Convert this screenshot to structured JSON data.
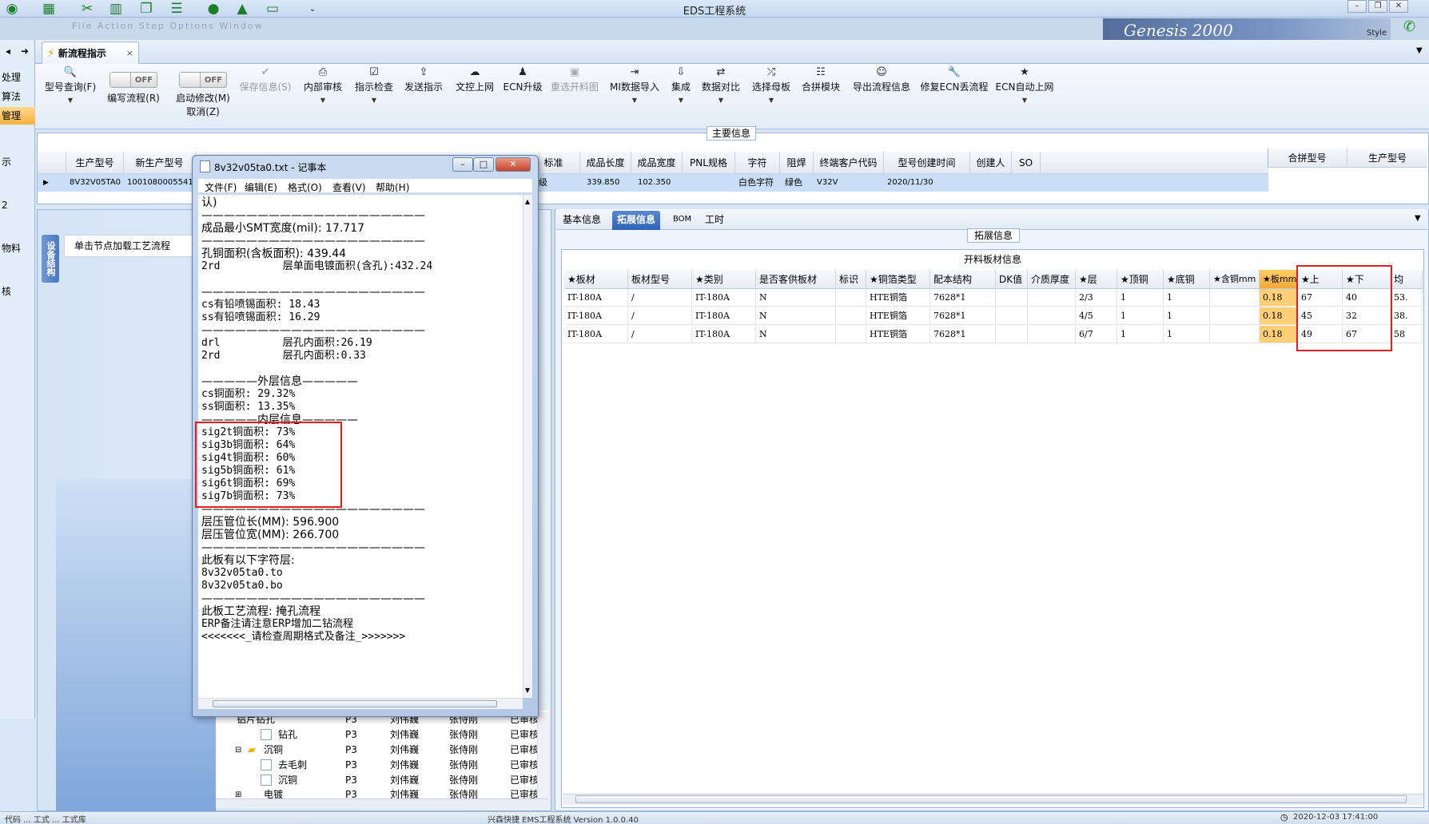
{
  "window": {
    "title": "EDS工程系统",
    "style_label": "Style",
    "genesis_banner": "Genesis 2000",
    "menu_ghost": "File  Action  Step  Options  Window"
  },
  "left_nav": {
    "items": [
      "处理",
      "算法",
      "管理",
      "示",
      "2",
      "物料",
      "核"
    ]
  },
  "doc_tab": {
    "label": "新流程指示",
    "close": "×"
  },
  "toolbar": {
    "items": [
      {
        "label": "型号查询(F)",
        "icon": "search-icon",
        "arrow": true,
        "disabled": false
      },
      {
        "label": "编写流程(R)",
        "toggle": "OFF",
        "disabled": false
      },
      {
        "label": "启动修改(M)",
        "label2": "取消(Z)",
        "toggle": "OFF",
        "disabled": false
      },
      {
        "label": "保存信息(S)",
        "icon": "check-icon",
        "disabled": true
      },
      {
        "label": "内部审核",
        "icon": "printer-icon",
        "arrow": true,
        "disabled": false
      },
      {
        "label": "指示检查",
        "icon": "checkbox-icon",
        "arrow": true,
        "disabled": false
      },
      {
        "label": "发送指示",
        "icon": "upload-icon",
        "disabled": false
      },
      {
        "label": "文控上网",
        "icon": "cloud-upload-icon",
        "disabled": false
      },
      {
        "label": "ECN升级",
        "icon": "people-icon",
        "disabled": false
      },
      {
        "label": "重选开料图",
        "icon": "image-icon",
        "disabled": true
      },
      {
        "label": "MI数据导入",
        "icon": "import-icon",
        "arrow": true,
        "disabled": false
      },
      {
        "label": "集成",
        "icon": "download-icon",
        "arrow": true,
        "disabled": false
      },
      {
        "label": "数据对比",
        "icon": "compare-icon",
        "arrow": true,
        "disabled": false
      },
      {
        "label": "选择母板",
        "icon": "shuffle-icon",
        "arrow": true,
        "disabled": false
      },
      {
        "label": "合拼模块",
        "icon": "list-icon",
        "disabled": false
      },
      {
        "label": "导出流程信息",
        "icon": "smiley-icon",
        "disabled": false
      },
      {
        "label": "修复ECN丢流程",
        "icon": "wrench-icon",
        "disabled": false
      },
      {
        "label": "ECN自动上网",
        "icon": "star-icon",
        "arrow": true,
        "disabled": false
      }
    ],
    "off_text": "OFF"
  },
  "main_info": {
    "label": "主要信息",
    "headers": [
      "生产型号",
      "新生产型号",
      "标准",
      "成品长度",
      "成品宽度",
      "PNL规格",
      "字符",
      "阻焊",
      "终端客户代码",
      "型号创建时间",
      "创建人",
      "SO"
    ],
    "row": {
      "prod_no": "8V32V05TA0",
      "new_prod_no": "10010800055417",
      "std": "级",
      "length": "339.850",
      "width": "102.350",
      "char": "白色字符",
      "mask": "绿色",
      "customer": "V32V",
      "created": "2020/11/30"
    },
    "right_headers": [
      "合拼型号",
      "生产型号"
    ]
  },
  "tree_panel": {
    "vtab": "设备结构",
    "tip": "单击节点加载工艺流程",
    "rows": [
      {
        "name": "铝片钻孔",
        "c1": "P3",
        "c2": "刘伟巍",
        "c3": "张侍刚",
        "c4": "已审核"
      },
      {
        "name": "钻孔",
        "c1": "P3",
        "c2": "刘伟巍",
        "c3": "张侍刚",
        "c4": "已审核"
      },
      {
        "name": "沉铜",
        "c1": "P3",
        "c2": "刘伟巍",
        "c3": "张侍刚",
        "c4": "已审核"
      },
      {
        "name": "去毛刺",
        "c1": "P3",
        "c2": "刘伟巍",
        "c3": "张侍刚",
        "c4": "已审核"
      },
      {
        "name": "沉铜",
        "c1": "P3",
        "c2": "刘伟巍",
        "c3": "张侍刚",
        "c4": "已审核"
      },
      {
        "name": "电镀",
        "c1": "P3",
        "c2": "刘伟巍",
        "c3": "张侍刚",
        "c4": "已审核"
      }
    ]
  },
  "right_tabs": [
    "基本信息",
    "拓展信息",
    "BOM",
    "工时"
  ],
  "ext_info": {
    "label": "拓展信息",
    "grid_title": "开料板材信息",
    "headers": [
      "★板材",
      "板材型号",
      "★类别",
      "是否客供板材",
      "标识",
      "★铜箔类型",
      "配本结构",
      "DK值",
      "介质厚度",
      "★层",
      "★顶铜",
      "★底铜",
      "★含铜mm",
      "★板mm",
      "★上",
      "★下",
      "均"
    ],
    "rows": [
      [
        "IT-180A",
        "/",
        "IT-180A",
        "N",
        "",
        "HTE铜箔",
        "7628*1",
        "",
        "",
        "2/3",
        "1",
        "1",
        "",
        "0.18",
        "67",
        "40",
        "53."
      ],
      [
        "IT-180A",
        "/",
        "IT-180A",
        "N",
        "",
        "HTE铜箔",
        "7628*1",
        "",
        "",
        "4/5",
        "1",
        "1",
        "",
        "0.18",
        "45",
        "32",
        "38."
      ],
      [
        "IT-180A",
        "/",
        "IT-180A",
        "N",
        "",
        "HTE铜箔",
        "7628*1",
        "",
        "",
        "6/7",
        "1",
        "1",
        "",
        "0.18",
        "49",
        "67",
        "58"
      ]
    ]
  },
  "notepad": {
    "title": "8v32v05ta0.txt - 记事本",
    "menu": [
      "文件(F)",
      "编辑(E)",
      "格式(O)",
      "查看(V)",
      "帮助(H)"
    ],
    "lines": [
      "认)",
      "————————————————————",
      "成品最小SMT宽度(mil): 17.717",
      "————————————————————",
      "孔铜面积(含板面积): 439.44",
      "2rd          层单面电镀面积(含孔):432.24",
      "",
      "————————————————————",
      "cs有铅喷锡面积: 18.43",
      "ss有铅喷锡面积: 16.29",
      "————————————————————",
      "drl          层孔内面积:26.19",
      "2rd          层孔内面积:0.33",
      "",
      "—————外层信息—————",
      "cs铜面积: 29.32%",
      "ss铜面积: 13.35%",
      "—————内层信息—————",
      "sig2t铜面积: 73%",
      "sig3b铜面积: 64%",
      "sig4t铜面积: 60%",
      "sig5b铜面积: 61%",
      "sig6t铜面积: 69%",
      "sig7b铜面积: 73%",
      "————————————————————",
      "层压管位长(MM): 596.900",
      "层压管位宽(MM): 266.700",
      "————————————————————",
      "此板有以下字符层:",
      "8v32v05ta0.to",
      "8v32v05ta0.bo",
      "————————————————————",
      "此板工艺流程: 掩孔流程",
      "ERP备注请注意ERP增加二钻流程",
      "<<<<<<<_请检查周期格式及备注_>>>>>>>"
    ]
  },
  "statusbar": {
    "left": "代码  ...  工式  ...  工式库",
    "center": "兴森快捷  EMS工程系统  Version 1.0.0.40",
    "right": "2020-12-03 17:41:00"
  }
}
